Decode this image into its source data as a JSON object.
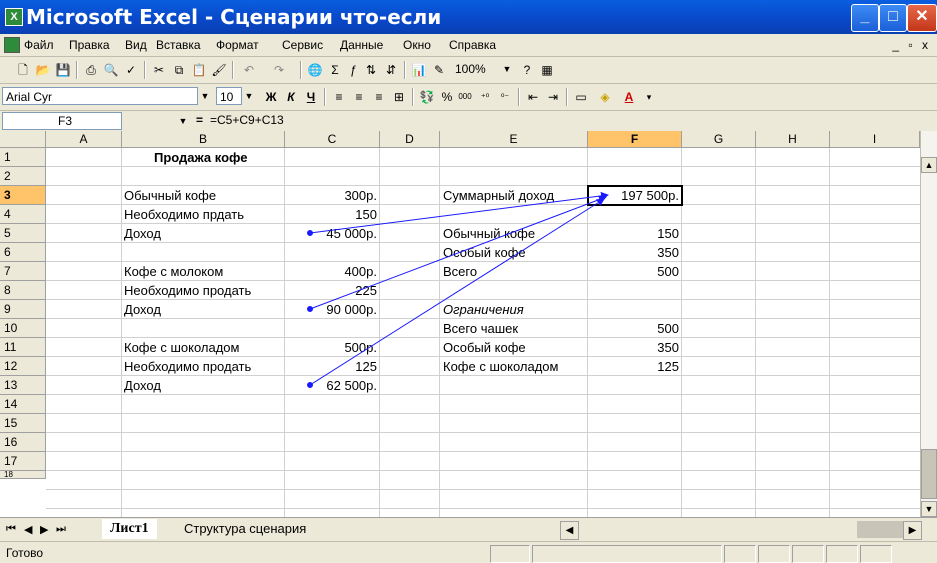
{
  "window": {
    "title": "Microsoft Excel - Сценарии что-если",
    "app_letter": "X"
  },
  "menu": {
    "items": [
      "Файл",
      "Правка",
      "Вид",
      "Вставка",
      "Формат",
      "Сервис",
      "Данные",
      "Окно",
      "Справка"
    ],
    "mdi_controls": "_ ▫ x"
  },
  "toolbar": {
    "zoom": "100%"
  },
  "format_toolbar": {
    "font": "Arial Cyr",
    "size": "10",
    "bold": "Ж",
    "italic": "К",
    "underline": "Ч",
    "percent": "%",
    "thousands": "000"
  },
  "formula_bar": {
    "name_box": "F3",
    "equals": "=",
    "formula": "=C5+C9+C13"
  },
  "columns": [
    "A",
    "B",
    "C",
    "D",
    "E",
    "F",
    "G",
    "H",
    "I"
  ],
  "rows": [
    "1",
    "2",
    "3",
    "4",
    "5",
    "6",
    "7",
    "8",
    "9",
    "10",
    "11",
    "12",
    "13",
    "14",
    "15",
    "16",
    "17",
    "18"
  ],
  "cells": {
    "b1": "Продажа кофе",
    "b3": "Обычный кофе",
    "c3": "300р.",
    "b4": "Необходимо прдать",
    "c4": "150",
    "b5": "Доход",
    "c5": "45 000р.",
    "b7": "Кофе с молоком",
    "c7": "400р.",
    "b8": "Необходимо продать",
    "c8": "225",
    "b9": "Доход",
    "c9": "90 000р.",
    "b11": "Кофе с шоколадом",
    "c11": "500р.",
    "b12": "Необходимо продать",
    "c12": "125",
    "b13": "Доход",
    "c13": "62 500р.",
    "e3": "Суммарный доход",
    "f3": "197 500р.",
    "e5": "Обычный кофе",
    "f5": "150",
    "e6": "Особый кофе",
    "f6": "350",
    "e7": "Всего",
    "f7": "500",
    "e9": "Ограничения",
    "e10": "Всего чашек",
    "f10": "500",
    "e11": "Особый кофе",
    "f11": "350",
    "e12": "Кофе с шоколадом",
    "f12": "125"
  },
  "sheet_tabs": [
    "Лист1",
    "Структура сценария"
  ],
  "status": "Готово",
  "colors": {
    "title_bar": "#0a5ee0",
    "arrow": "#1a1aff",
    "header_highlight": "#ffc36a"
  }
}
